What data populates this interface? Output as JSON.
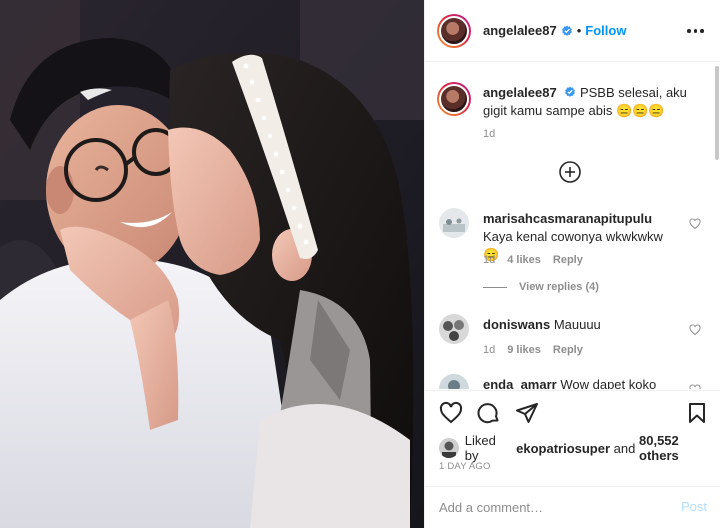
{
  "post": {
    "author": "angelalee87",
    "follow_label": "Follow",
    "separator": "•",
    "photo_alt": "selfie photo"
  },
  "caption": {
    "username": "angelalee87",
    "text": "PSBB selesai, aku gigit kamu sampe abis 😑😑😑",
    "time": "1d"
  },
  "comments": [
    {
      "username": "marisahcasmaranapitupulu",
      "text": "Kaya kenal cowonya wkwkwkw 😑",
      "time": "1d",
      "likes": "4 likes",
      "reply": "Reply",
      "view_replies": "View replies (4)"
    },
    {
      "username": "doniswans",
      "text": "Mauuuu",
      "time": "1d",
      "likes": "9 likes",
      "reply": "Reply"
    },
    {
      "username": "enda_amarr",
      "text": "Wow dapet koko"
    }
  ],
  "likes": {
    "prefix": "Liked by",
    "user": "ekopatriosuper",
    "middle": "and",
    "count": "80,552 others"
  },
  "date": "1 DAY AGO",
  "add_comment": {
    "placeholder": "Add a comment…",
    "post_label": "Post"
  },
  "icons": {
    "verified": "verified-badge-icon",
    "more": "more-options-icon",
    "load_more": "plus-circle-icon",
    "heart": "heart-icon",
    "comment": "comment-icon",
    "share": "paper-plane-icon",
    "save": "bookmark-icon"
  },
  "colors": {
    "link_blue": "#0095f6",
    "muted_gray": "#8e8e8e",
    "text": "#262626",
    "post_disabled": "#b2dffc",
    "verified": "#3897f0"
  }
}
